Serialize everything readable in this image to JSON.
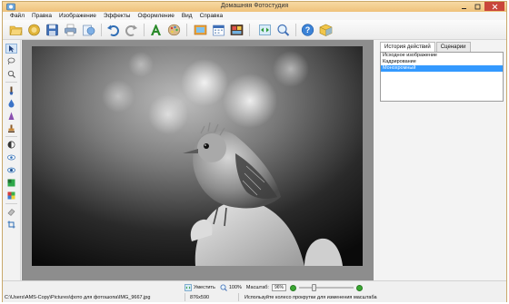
{
  "window": {
    "title": "Домашняя Фотостудия"
  },
  "menu": [
    "Файл",
    "Правка",
    "Изображение",
    "Эффекты",
    "Оформление",
    "Вид",
    "Справка"
  ],
  "toolbar": {
    "buttons": [
      "open-folder-icon",
      "browse-photos-icon",
      "save-icon",
      "print-icon",
      "export-icon",
      "undo-icon",
      "redo-icon",
      "add-text-icon",
      "palette-icon",
      "frame-icon",
      "calendar-icon",
      "collage-icon",
      "fit-icon",
      "zoom-icon",
      "help-icon",
      "box-icon"
    ]
  },
  "left_tools": [
    "select-arrow-icon",
    "lasso-icon",
    "magnifier-tool-icon",
    "brush-icon",
    "drop-icon",
    "cone-icon",
    "stamp-icon",
    "contrast-icon",
    "redeye-icon",
    "eye-icon",
    "gradient-icon",
    "color-swatch-icon",
    "eraser-icon",
    "crop-icon"
  ],
  "panel": {
    "tabs": [
      "История действий",
      "Сценарии"
    ],
    "history": [
      "Исходное изображение",
      "Кадрирование",
      "Монохромный"
    ],
    "selected_index": 2
  },
  "zoom": {
    "fit_label": "Уместить",
    "actual_label": "100%",
    "scale_label": "Масштаб:",
    "scale_value": "96%"
  },
  "status": {
    "path": "C:\\Users\\AMS-Copy\\Pictures\\фото для фотошопа\\IMG_9667.jpg",
    "dimensions": "876x590",
    "hint": "Используйте колесо прокрутки для изменения масштаба"
  },
  "colors": {
    "titlebar": "#efc27b",
    "close_button": "#c9453a",
    "selection": "#3399ff",
    "zoom_green": "#3aa832"
  }
}
